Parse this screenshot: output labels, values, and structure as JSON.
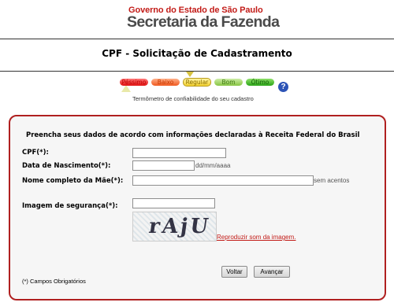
{
  "header": {
    "government_line": "Governo do Estado de São Paulo",
    "secretariat_line": "Secretaria da Fazenda"
  },
  "page": {
    "title": "CPF - Solicitação de Cadastramento"
  },
  "thermometer": {
    "levels": [
      "Péssimo",
      "Baixo",
      "Regular",
      "Bom",
      "Ótimo"
    ],
    "current_level": "Regular",
    "caption": "Termômetro de confiabilidade do seu cadastro",
    "help_icon": "question-icon"
  },
  "form": {
    "heading": "Preencha seus dados de acordo com informações declaradas à Receita Federal do Brasil",
    "cpf_label": "CPF(*):",
    "cpf_value": "",
    "birth_label": "Data de Nascimento(*):",
    "birth_value": "",
    "birth_hint": "dd/mm/aaaa",
    "mother_label": "Nome completo da Mãe(*):",
    "mother_value": "",
    "mother_hint": "sem acentos",
    "captcha_label": "Imagem de segurança(*):",
    "captcha_value": "",
    "captcha_image_text": "rAjU",
    "audio_link": "Reproduzir som da imagem.",
    "back_button": "Voltar",
    "next_button": "Avançar",
    "required_note": "(*) Campos Obrigatórios"
  },
  "colors": {
    "brand_red": "#c21b17",
    "border_red": "#b02020",
    "help_blue": "#2c53b6"
  }
}
